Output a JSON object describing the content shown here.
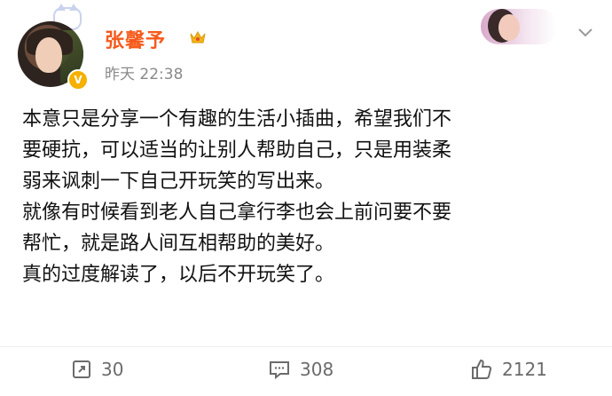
{
  "post": {
    "user_name": "张馨予",
    "time": "昨天 22:38",
    "text_lines": [
      "本意只是分享一个有趣的生活小插曲，希望我们不",
      "要硬抗，可以适当的让别人帮助自己，只是用装柔",
      "弱来讽刺一下自己开玩笑的写出来。",
      "就像有时候看到老人自己拿行李也会上前问要不要",
      "帮忙，就是路人间互相帮助的美好。",
      "真的过度解读了，以后不开玩笑了。"
    ]
  },
  "actions": {
    "repost_count": "30",
    "comment_count": "308",
    "like_count": "2121"
  },
  "icons": {
    "avatar": "avatar-icon",
    "verify": "verified-badge-icon",
    "crown": "crown-icon",
    "menu": "chevron-down-icon",
    "repost": "repost-icon",
    "comment": "comment-icon",
    "like": "thumbs-up-icon"
  },
  "colors": {
    "name": "#f55a1b",
    "text": "#111111",
    "meta": "#8a8a8a",
    "actions": "#6b6b6b",
    "badge": "#f5b000"
  }
}
